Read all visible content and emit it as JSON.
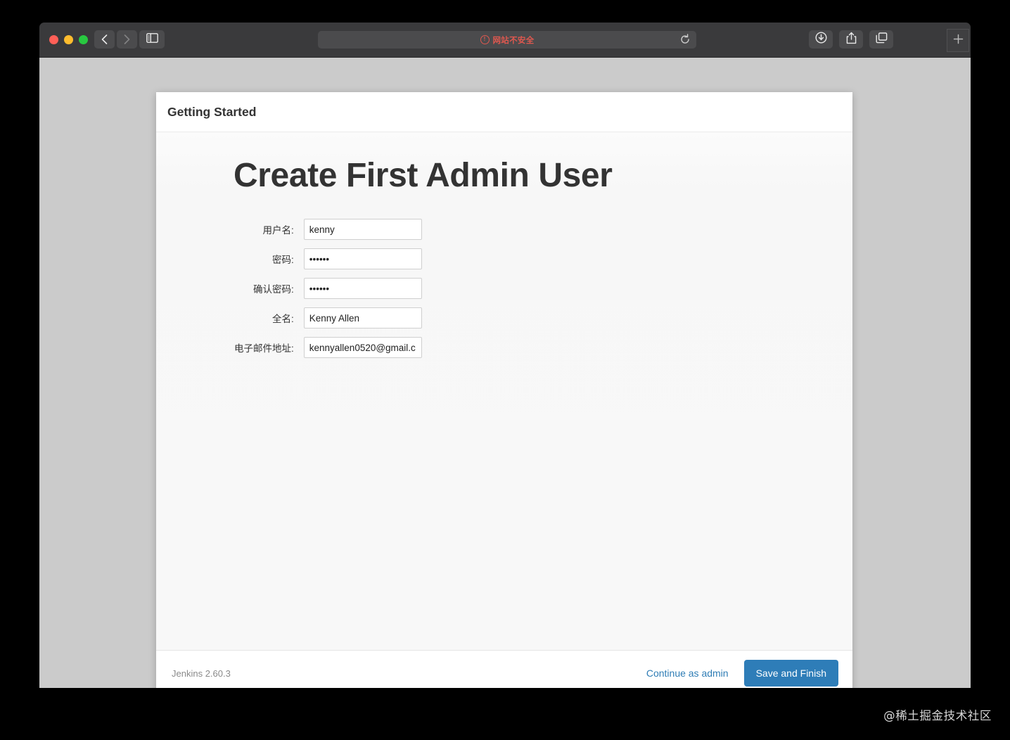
{
  "browser": {
    "window_controls": {
      "close_label": "close",
      "minimize_label": "minimize",
      "zoom_label": "zoom"
    },
    "back_label": "Back",
    "forward_label": "Forward",
    "sidebar_label": "Show Sidebar",
    "address": {
      "warning_glyph": "!",
      "text": "网站不安全",
      "text_color": "#e0584f",
      "reload_label": "Reload"
    },
    "tools": {
      "downloads_label": "Downloads",
      "share_label": "Share",
      "tab_overview_label": "Tab Overview",
      "new_tab_label": "+"
    }
  },
  "page": {
    "header": {
      "title": "Getting Started"
    },
    "main": {
      "title": "Create First Admin User",
      "fields": [
        {
          "label": "用户名:",
          "value": "kenny",
          "type": "text",
          "name": "username"
        },
        {
          "label": "密码:",
          "value": "••••••",
          "type": "password",
          "name": "password"
        },
        {
          "label": "确认密码:",
          "value": "••••••",
          "type": "password",
          "name": "confirm-password"
        },
        {
          "label": "全名:",
          "value": "Kenny Allen",
          "type": "text",
          "name": "fullname"
        },
        {
          "label": "电子邮件地址:",
          "value": "kennyallen0520@gmail.c",
          "type": "text",
          "name": "email"
        }
      ]
    },
    "footer": {
      "version": "Jenkins 2.60.3",
      "continue_link": "Continue as admin",
      "save_button": "Save and Finish",
      "save_button_color": "#2e7db8"
    }
  },
  "watermark": {
    "text": "@稀土掘金技术社区"
  }
}
